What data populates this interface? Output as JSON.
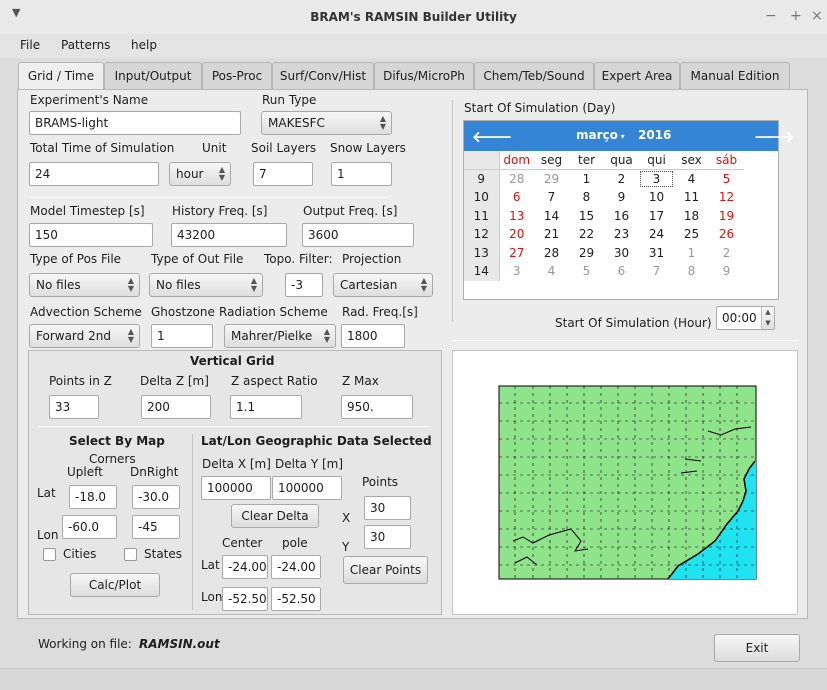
{
  "window": {
    "title": "BRAM's RAMSIN Builder Utility",
    "controls": [
      "−",
      "+",
      "×"
    ]
  },
  "menubar": [
    "File",
    "Patterns",
    "help"
  ],
  "tabs": [
    "Grid / Time",
    "Input/Output",
    "Pos-Proc",
    "Surf/Conv/Hist",
    "Difus/MicroPh",
    "Chem/Teb/Sound",
    "Expert Area",
    "Manual Edition"
  ],
  "form": {
    "experiment_name_label": "Experiment's Name",
    "experiment_name_value": "BRAMS-light",
    "run_type_label": "Run Type",
    "run_type_value": "MAKESFC",
    "total_time_label": "Total Time of Simulation",
    "total_time_value": "24",
    "unit_label": "Unit",
    "unit_value": "hour",
    "soil_layers_label": "Soil Layers",
    "soil_layers_value": "7",
    "snow_layers_label": "Snow Layers",
    "snow_layers_value": "1",
    "model_timestep_label": "Model Timestep [s]",
    "model_timestep_value": "150",
    "history_freq_label": "History Freq. [s]",
    "history_freq_value": "43200",
    "output_freq_label": "Output Freq. [s]",
    "output_freq_value": "3600",
    "pos_file_label": "Type of Pos File",
    "pos_file_value": "No files",
    "out_file_label": "Type of Out File",
    "out_file_value": "No files",
    "topo_filter_label": "Topo. Filter:",
    "topo_filter_value": "-3",
    "projection_label": "Projection",
    "projection_value": "Cartesian",
    "advection_label": "Advection Scheme",
    "advection_value": "Forward 2nd",
    "ghostzone_label": "Ghostzone",
    "ghostzone_value": "1",
    "radiation_label": "Radiation Scheme",
    "radiation_value": "Mahrer/Pielke",
    "rad_freq_label": "Rad. Freq.[s]",
    "rad_freq_value": "1800"
  },
  "vertical_grid": {
    "title": "Vertical Grid",
    "points_label": "Points in Z",
    "points_value": "33",
    "deltaz_label": "Delta Z [m]",
    "deltaz_value": "200",
    "aspect_label": "Z aspect Ratio",
    "aspect_value": "1.1",
    "zmax_label": "Z Max",
    "zmax_value": "950."
  },
  "select_map": {
    "title": "Select By Map",
    "corners_label": "Corners",
    "upleft_label": "Upleft",
    "dnright_label": "DnRight",
    "lat_label": "Lat",
    "lon_label": "Lon",
    "lat_upleft": "-18.0",
    "lat_dnright": "-30.0",
    "lon_upleft": "-60.0",
    "lon_dnright": "-45",
    "cities_label": "Cities",
    "states_label": "States",
    "calc_plot_label": "Calc/Plot"
  },
  "latlon": {
    "title": "Lat/Lon Geographic Data Selected",
    "delta_x_label": "Delta X [m]",
    "delta_y_label": "Delta Y [m]",
    "delta_x_value": "100000",
    "delta_y_value": "100000",
    "clear_delta_label": "Clear Delta",
    "points_label": "Points",
    "x_label": "X",
    "y_label": "Y",
    "x_value": "30",
    "y_value": "30",
    "center_label": "Center",
    "pole_label": "pole",
    "lat_label": "Lat",
    "lon_label": "Lon",
    "lat_center": "-24.00",
    "lat_pole": "-24.00",
    "lon_center": "-52.50",
    "lon_pole": "-52.50",
    "clear_points_label": "Clear Points"
  },
  "calendar": {
    "section_label": "Start Of Simulation (Day)",
    "month": "março",
    "year": "2016",
    "weekdays": [
      "dom",
      "seg",
      "ter",
      "qua",
      "qui",
      "sex",
      "sáb"
    ],
    "weeks": [
      {
        "wk": "9",
        "days": [
          "28",
          "29",
          "1",
          "2",
          "3",
          "4",
          "5"
        ]
      },
      {
        "wk": "10",
        "days": [
          "6",
          "7",
          "8",
          "9",
          "10",
          "11",
          "12"
        ]
      },
      {
        "wk": "11",
        "days": [
          "13",
          "14",
          "15",
          "16",
          "17",
          "18",
          "19"
        ]
      },
      {
        "wk": "12",
        "days": [
          "20",
          "21",
          "22",
          "23",
          "24",
          "25",
          "26"
        ]
      },
      {
        "wk": "13",
        "days": [
          "27",
          "28",
          "29",
          "30",
          "31",
          "1",
          "2"
        ]
      },
      {
        "wk": "14",
        "days": [
          "3",
          "4",
          "5",
          "6",
          "7",
          "8",
          "9"
        ]
      }
    ],
    "hour_label": "Start Of Simulation (Hour)",
    "hour_value": "00:00"
  },
  "map": {
    "land_color": "#8fe38a",
    "sea_color": "#1fe3f0"
  },
  "footer": {
    "working_label": "Working on file:",
    "file_name": "RAMSIN.out",
    "exit_label": "Exit"
  }
}
